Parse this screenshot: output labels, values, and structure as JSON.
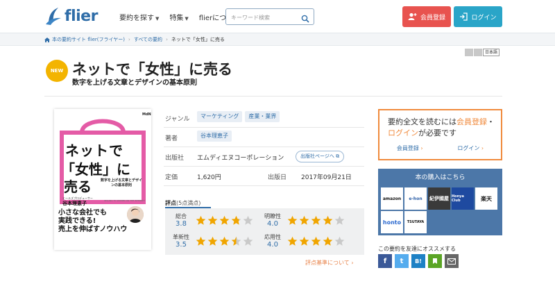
{
  "header": {
    "logo_text": "flier",
    "nav": [
      "要約を探す",
      "特集",
      "flierについて"
    ],
    "search_placeholder": "キーワード検索",
    "register_label": "会員登録",
    "login_label": "ログイン"
  },
  "breadcrumb": {
    "home": "本の要約サイト flier(フライヤー)",
    "all": "すべての要約",
    "current": "ネットで「女性」に売る"
  },
  "lang": [
    "",
    "",
    "日本語"
  ],
  "badge": "NEW",
  "title": "ネットで「女性」に売る",
  "subtitle": "数字を上げる文章とデザインの基本原則",
  "cover": {
    "publisher_mark": "MdN",
    "line1": "ネットで",
    "line2": "「女性」に",
    "line3": "売る",
    "sub": "数字を上げる文章とデザインの基本原則",
    "author_label": "ヒールズプロデューサー",
    "author": "谷本理恵子",
    "english": "SELLING TO WOMEN ON THE INTERNET",
    "catch1": "小さな会社でも",
    "catch2": "実践できる!",
    "catch3": "売上を伸ばすノウハウ"
  },
  "info": {
    "genre_label": "ジャンル",
    "genres": [
      "マーケティング",
      "産業・業界"
    ],
    "author_label": "著者",
    "author": "谷本理恵子",
    "publisher_label": "出版社",
    "publisher": "エムディエヌコーポレーション",
    "publisher_link": "出版社ページへ",
    "price_label": "定価",
    "price": "1,620円",
    "date_label": "出版日",
    "date": "2017年09月21日"
  },
  "rating": {
    "heading": "評点",
    "scale": "(5点満点)",
    "items": [
      {
        "label": "総合",
        "value": "3.8",
        "score": 3.8
      },
      {
        "label": "明瞭性",
        "value": "4.0",
        "score": 4.0
      },
      {
        "label": "革新性",
        "value": "3.5",
        "score": 3.5
      },
      {
        "label": "応用性",
        "value": "4.0",
        "score": 4.0
      }
    ],
    "criteria_link": "評点基準について"
  },
  "signup": {
    "text_pre": "要約全文を読むには",
    "register": "会員登録",
    "dot": "・",
    "login": "ログイン",
    "text_post": "が必要です",
    "link_register": "会員登録",
    "link_login": "ログイン"
  },
  "buy": {
    "title": "本の購入はこちら",
    "stores": [
      "amazon",
      "e-hon",
      "紀伊國屋",
      "Honya Club",
      "楽天",
      "honto",
      "TSUTAYA"
    ]
  },
  "share": {
    "label": "この要約を友達にオススメする",
    "buttons": [
      "f",
      "t",
      "B!",
      "e",
      "mail"
    ]
  },
  "colors": {
    "brand": "#2f6da8",
    "register": "#e8534f",
    "login": "#2aa5c8",
    "accent": "#f08a3c",
    "badge": "#f3b400"
  }
}
